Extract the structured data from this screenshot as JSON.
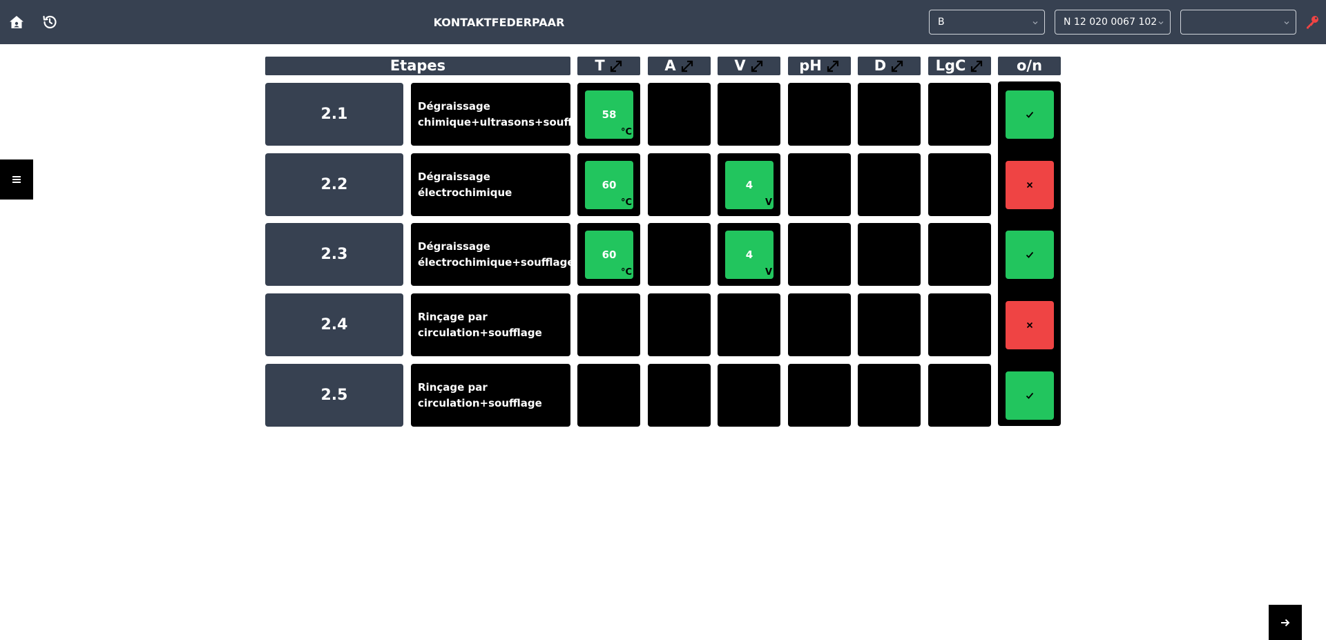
{
  "header": {
    "title": "KONTAKTFEDERPAAR",
    "home_icon": "home-icon",
    "history_icon": "history-icon",
    "select_1": "B",
    "select_2": "N 12 020 0067 102",
    "select_3": "",
    "key_icon": "key-icon",
    "key_color": "#ef4444"
  },
  "side_menu": {
    "icon": "menu-icon"
  },
  "next_button": {
    "icon": "arrow-right-icon"
  },
  "table": {
    "headers": {
      "etapes": "Etapes",
      "t": "T",
      "a": "A",
      "v": "V",
      "ph": "pH",
      "d": "D",
      "lgc": "LgC",
      "on": "o/n"
    },
    "rows": [
      {
        "step": "2.1",
        "description": "Dégraissage\nchimique+ultrasons+soufflage",
        "t": {
          "value": "58",
          "unit": "°C"
        },
        "v": null,
        "status": "ok"
      },
      {
        "step": "2.2",
        "description": "Dégraissage électrochimique",
        "t": {
          "value": "60",
          "unit": "°C"
        },
        "v": {
          "value": "4",
          "unit": "V"
        },
        "status": "ko"
      },
      {
        "step": "2.3",
        "description": "Dégraissage\nélectrochimique+soufflage",
        "t": {
          "value": "60",
          "unit": "°C"
        },
        "v": {
          "value": "4",
          "unit": "V"
        },
        "status": "ok"
      },
      {
        "step": "2.4",
        "description": "Rinçage par\ncirculation+soufflage",
        "t": null,
        "v": null,
        "status": "ko"
      },
      {
        "step": "2.5",
        "description": "Rinçage par\ncirculation+soufflage",
        "t": null,
        "v": null,
        "status": "ok"
      }
    ]
  },
  "colors": {
    "bar": "#374151",
    "ok": "#22c55e",
    "ko": "#ef4444"
  }
}
